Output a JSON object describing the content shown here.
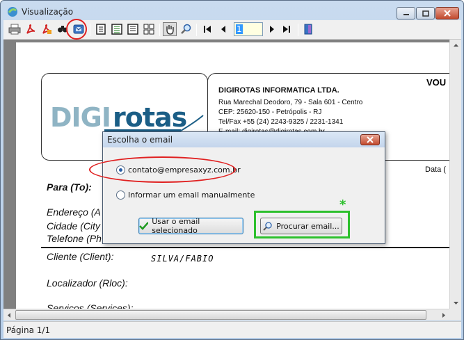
{
  "window": {
    "title": "Visualização"
  },
  "toolbar": {
    "page_value": "1",
    "buttons": [
      "print-icon",
      "pdf-icon",
      "pdf-export-icon",
      "find-icon",
      "email-icon",
      "page-single-icon",
      "page-double-icon",
      "page-wide-icon",
      "page-grid-icon",
      "hand-icon",
      "zoom-icon",
      "first-page-icon",
      "prev-page-icon",
      "next-page-icon",
      "last-page-icon",
      "exit-icon"
    ]
  },
  "report": {
    "company_name": "DIGIROTAS INFORMATICA LTDA.",
    "address": "Rua Marechal Deodoro, 79 - Sala 601 - Centro",
    "cep": "CEP: 25620-150 - Petrópolis - RJ",
    "phone": "Tel/Fax +55 (24) 2243-9325 / 2231-1341",
    "email": "E-mail: digirotas@digirotas.com.br",
    "doc_label": "VOU",
    "date_label": "Data (",
    "para": "Para (To):",
    "endereco": "Endereço (A",
    "cidade": "Cidade (City",
    "telefone": "Telefone (Ph",
    "cliente_label": "Cliente (Client):",
    "cliente_value": "SILVA/FABIO",
    "localizador_label": "Localizador (Rloc):",
    "servicos_label": "Serviços (Services):",
    "logo_text_1": "DIGI",
    "logo_text_2": "rotas"
  },
  "dialog": {
    "title": "Escolha o email",
    "option_1": "contato@empresaxyz.com.br",
    "option_2": "Informar um email manualmente",
    "btn_use": "Usar o email selecionado",
    "btn_search": "Procurar email..."
  },
  "status": {
    "text": "Página 1/1"
  },
  "colors": {
    "annotation_red": "#e02020",
    "annotation_green": "#2dc02d",
    "logo_blue": "#1b5e86"
  }
}
